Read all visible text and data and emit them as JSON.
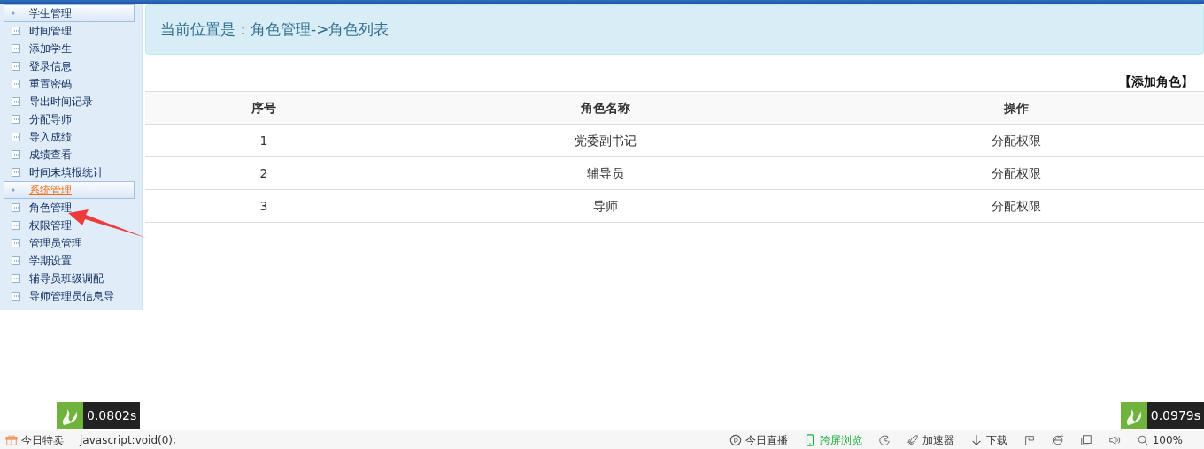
{
  "sidebar": {
    "groups": [
      {
        "label": "学生管理",
        "selected": false,
        "items": [
          "时间管理",
          "添加学生",
          "登录信息",
          "重置密码",
          "导出时间记录",
          "分配导师",
          "导入成绩",
          "成绩查看",
          "时间未填报统计"
        ]
      },
      {
        "label": "系统管理",
        "selected": true,
        "items": [
          "角色管理",
          "权限管理",
          "管理员管理",
          "学期设置",
          "辅导员班级调配",
          "导师管理员信息导"
        ]
      }
    ]
  },
  "breadcrumb": "当前位置是：角色管理->角色列表",
  "add_link": "【添加角色】",
  "table": {
    "columns": [
      "序号",
      "角色名称",
      "操作"
    ],
    "rows": [
      {
        "index": "1",
        "name": "党委副书记",
        "action": "分配权限"
      },
      {
        "index": "2",
        "name": "辅导员",
        "action": "分配权限"
      },
      {
        "index": "3",
        "name": "导师",
        "action": "分配权限"
      }
    ]
  },
  "timers": [
    "0.0802s",
    "0.0979s"
  ],
  "status_bar": {
    "left": [
      {
        "kind": "gift",
        "label": "今日特卖"
      },
      {
        "kind": "text",
        "label": "javascript:void(0);"
      }
    ],
    "right": [
      {
        "kind": "play",
        "label": "今日直播",
        "highlighted": false
      },
      {
        "kind": "phone",
        "label": "跨屏浏览",
        "highlighted": true
      },
      {
        "kind": "clock",
        "highlighted": false
      },
      {
        "kind": "rocket",
        "label": "加速器",
        "highlighted": false
      },
      {
        "kind": "download",
        "label": "下载",
        "highlighted": false
      },
      {
        "kind": "flag",
        "highlighted": false
      },
      {
        "kind": "browser",
        "highlighted": false
      },
      {
        "kind": "window",
        "highlighted": false
      },
      {
        "kind": "speaker",
        "highlighted": false
      },
      {
        "kind": "zoom",
        "label": "100%",
        "highlighted": false
      }
    ]
  }
}
